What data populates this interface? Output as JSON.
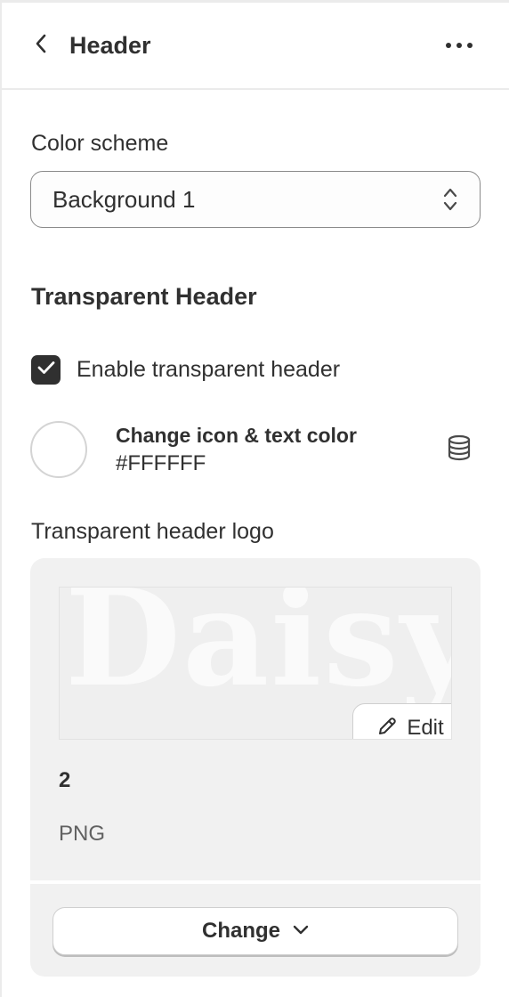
{
  "header": {
    "title": "Header",
    "back_icon": "chevron-left-icon",
    "more_icon": "more-horizontal-icon"
  },
  "color_scheme": {
    "label": "Color scheme",
    "selected": "Background 1",
    "icon": "select-arrows-icon"
  },
  "transparent_header": {
    "section_title": "Transparent Header",
    "enable_checkbox": {
      "label": "Enable transparent header",
      "checked": true
    },
    "icon_text_color": {
      "title": "Change icon & text color",
      "value": "#FFFFFF",
      "swatch_color": "#FFFFFF",
      "dynamic_source_icon": "database-icon"
    },
    "logo": {
      "label": "Transparent header logo",
      "preview_text": "Daisy",
      "edit_label": "Edit",
      "file_name": "2",
      "file_type": "PNG",
      "change_label": "Change"
    }
  },
  "colors": {
    "text": "#303030",
    "border": "#8a8a8a",
    "card_background": "#f1f1f1",
    "checkbox_fill": "#303030"
  }
}
